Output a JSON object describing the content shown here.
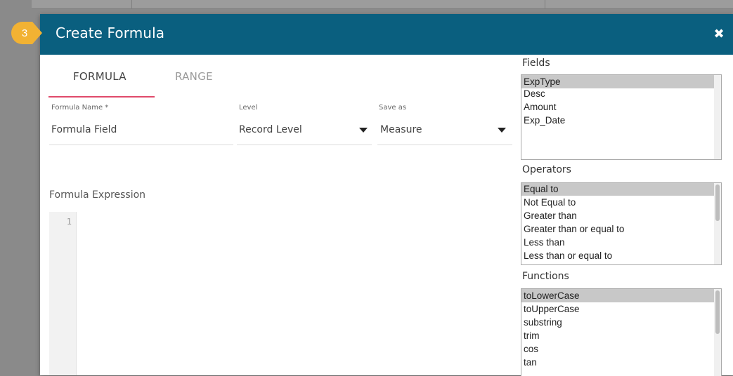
{
  "dialog": {
    "title": "Create Formula",
    "step": "3",
    "close_icon": "close-icon"
  },
  "tabs": [
    {
      "label": "FORMULA",
      "active": true
    },
    {
      "label": "RANGE",
      "active": false
    }
  ],
  "form": {
    "formula_name_label": "Formula Name *",
    "formula_name_value": "Formula Field",
    "level_label": "Level",
    "level_value": "Record Level",
    "save_as_label": "Save as",
    "save_as_value": "Measure"
  },
  "expression": {
    "label": "Formula Expression",
    "line_numbers": [
      "1"
    ]
  },
  "fields": {
    "title": "Fields",
    "items": [
      "ExpType",
      "Desc",
      "Amount",
      "Exp_Date"
    ],
    "selected": "ExpType"
  },
  "operators": {
    "title": "Operators",
    "items": [
      "Equal to",
      "Not Equal to",
      "Greater than",
      "Greater than or equal to",
      "Less than",
      "Less than or equal to"
    ],
    "selected": "Equal to"
  },
  "functions": {
    "title": "Functions",
    "items": [
      "toLowerCase",
      "toUpperCase",
      "substring",
      "trim",
      "cos",
      "tan"
    ],
    "selected": "toLowerCase"
  },
  "colors": {
    "header": "#0a5f7f",
    "tab_underline": "#e04a6a",
    "step_badge": "#f2b233"
  }
}
